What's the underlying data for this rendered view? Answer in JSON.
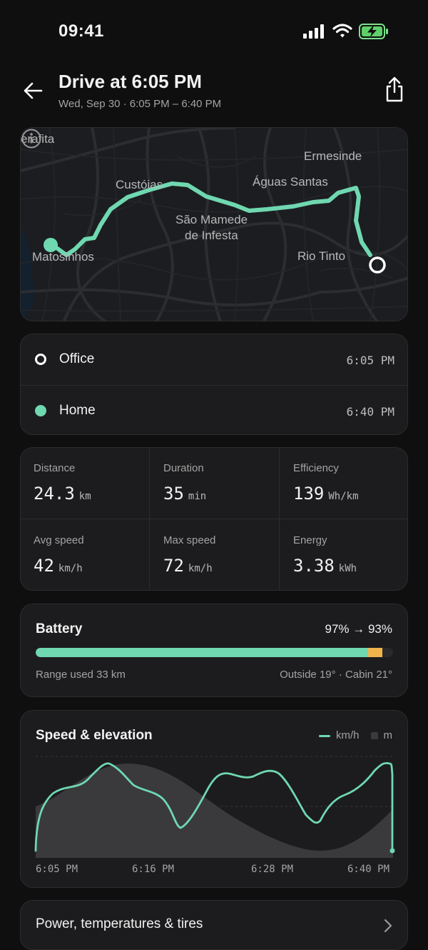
{
  "status": {
    "time": "09:41"
  },
  "header": {
    "title": "Drive at 6:05 PM",
    "subtitle": "Wed, Sep 30 · 6:05 PM – 6:40 PM"
  },
  "map": {
    "labels": [
      "erafita",
      "Ermesinde",
      "Custóias",
      "Águas Santas",
      "São Mamede",
      "de Infesta",
      "Matosinhos",
      "Rio Tinto"
    ]
  },
  "stops": [
    {
      "name": "Office",
      "time": "6:05 PM"
    },
    {
      "name": "Home",
      "time": "6:40 PM"
    }
  ],
  "stats": [
    {
      "label": "Distance",
      "value": "24.3",
      "unit": "km"
    },
    {
      "label": "Duration",
      "value": "35",
      "unit": "min"
    },
    {
      "label": "Efficiency",
      "value": "139",
      "unit": "Wh/km"
    },
    {
      "label": "Avg speed",
      "value": "42",
      "unit": "km/h"
    },
    {
      "label": "Max speed",
      "value": "72",
      "unit": "km/h"
    },
    {
      "label": "Energy",
      "value": "3.38",
      "unit": "kWh"
    }
  ],
  "battery": {
    "title": "Battery",
    "change": "97% → 93%",
    "start_pct": 97,
    "end_pct": 93,
    "range_used": "Range used 33 km",
    "temps": "Outside 19° · Cabin 21°"
  },
  "chart": {
    "title": "Speed & elevation",
    "legend_speed": "km/h",
    "legend_elev": "m",
    "ticks": [
      "6:05 PM",
      "6:16 PM",
      "6:28 PM",
      "6:40 PM"
    ]
  },
  "more": {
    "label": "Power, temperatures & tires"
  },
  "colors": {
    "accent": "#6fd8b0",
    "battery_used": "#f0b44a",
    "card": "#1c1c1e",
    "background": "#0f0f10"
  }
}
